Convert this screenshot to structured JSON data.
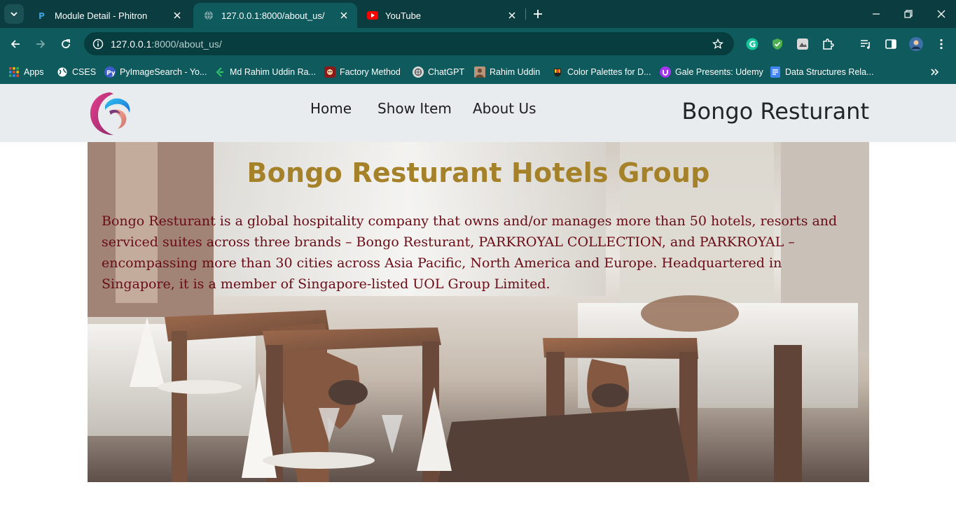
{
  "browser": {
    "tabs": [
      {
        "title": "Module Detail - Phitron",
        "active": false
      },
      {
        "title": "127.0.0.1:8000/about_us/",
        "active": true
      },
      {
        "title": "YouTube",
        "active": false
      }
    ],
    "address": {
      "host": "127.0.0.1",
      "rest": ":8000/about_us/"
    },
    "bookmarks": [
      {
        "label": "Apps",
        "icon": "apps-grid-icon"
      },
      {
        "label": "CSES",
        "icon": "globe-icon"
      },
      {
        "label": "PyImageSearch - Yo...",
        "icon": "pyimagesearch-icon"
      },
      {
        "label": "Md Rahim Uddin Ra...",
        "icon": "leetcode-icon"
      },
      {
        "label": "Factory Method",
        "icon": "refactoring-icon"
      },
      {
        "label": "ChatGPT",
        "icon": "chatgpt-icon"
      },
      {
        "label": "Rahim Uddin",
        "icon": "avatar-icon"
      },
      {
        "label": "Color Palettes for D...",
        "icon": "palette-icon"
      },
      {
        "label": "Gale Presents: Udemy",
        "icon": "udemy-icon"
      },
      {
        "label": "Data Structures Rela...",
        "icon": "docs-icon"
      }
    ]
  },
  "site": {
    "nav": [
      "Home",
      "Show Item",
      "About Us"
    ],
    "brand": "Bongo Resturant"
  },
  "hero": {
    "title": "Bongo Resturant Hotels Group",
    "text": "Bongo Resturant is a global hospitality company that owns and/or manages more than 50 hotels, resorts and serviced suites across three brands – Bongo Resturant, PARKROYAL COLLECTION, and PARKROYAL – encompassing more than 30 cities across Asia Pacific, North America and Europe. Headquartered in Singapore, it is a member of Singapore-listed UOL Group Limited."
  },
  "colors": {
    "chrome_dark": "#0b3d40",
    "chrome": "#0f5a5c",
    "navbar_bg": "#e9ecef",
    "title_gold": "#a5822a",
    "text_maroon": "#6a0b16"
  }
}
